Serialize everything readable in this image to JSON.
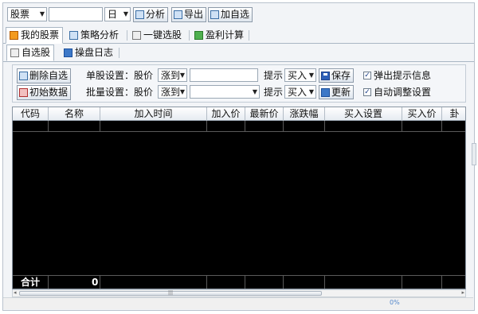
{
  "toolbar": {
    "category_value": "股票",
    "search_value": "",
    "period_value": "日",
    "analyze_label": "分析",
    "export_label": "导出",
    "add_favorite_label": "加自选"
  },
  "main_tabs": [
    "我的股票",
    "策略分析",
    "一键选股",
    "盈利计算"
  ],
  "sub_tabs": [
    "自选股",
    "操盘日志"
  ],
  "settings": {
    "delete_label": "删除自选",
    "init_label": "初始数据",
    "single_label": "单股设置：股价",
    "batch_label": "批量设置：股价",
    "single_direction": "涨到",
    "batch_direction": "涨到",
    "single_price_value": "",
    "batch_price_value": "",
    "alert_label": "提示",
    "single_alert_value": "买入",
    "batch_alert_value": "买入",
    "save_label": "保存",
    "update_label": "更新",
    "popup_label": "弹出提示信息",
    "popup_checked": true,
    "auto_adjust_label": "自动调整设置",
    "auto_adjust_checked": true
  },
  "table": {
    "columns": [
      "代码",
      "名称",
      "加入时间",
      "加入价",
      "最新价",
      "涨跌幅",
      "买入设置",
      "买入价",
      "卦"
    ],
    "footer_label": "合计",
    "footer_count": "0"
  },
  "status": {
    "progress_text": "0%"
  },
  "colors": {
    "grid_background": "#000000",
    "window_background": "#f2f4f7"
  }
}
